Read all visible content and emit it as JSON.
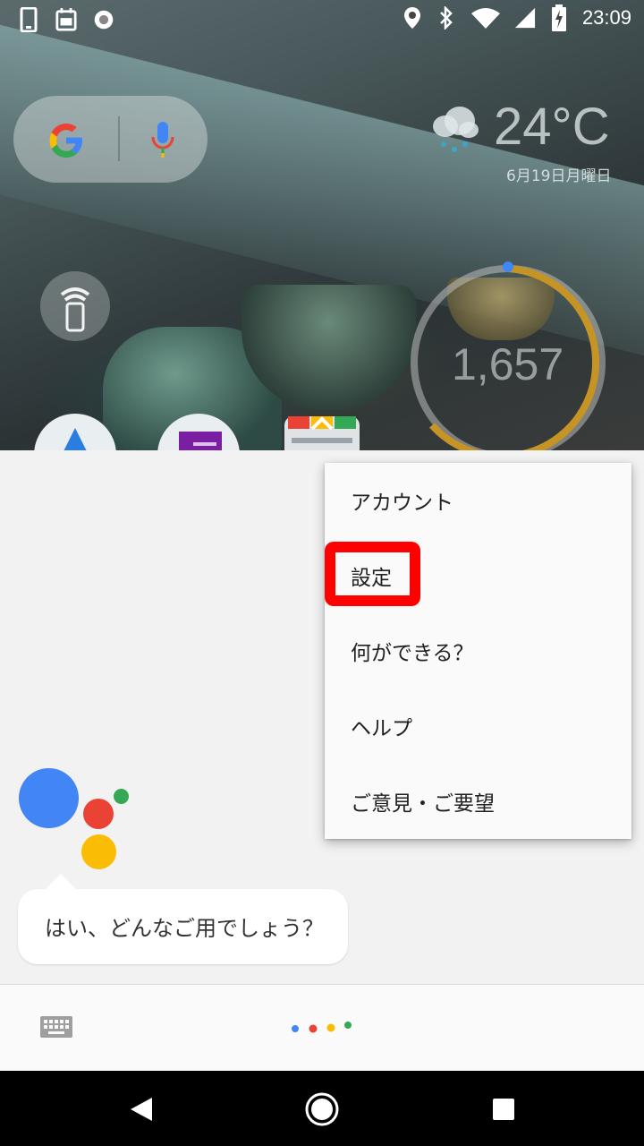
{
  "status_bar": {
    "time": "23:09",
    "left_icons": [
      "phone-outline-icon",
      "calendar-100-icon",
      "record-icon"
    ],
    "right_icons": [
      "location-icon",
      "bluetooth-icon",
      "wifi-icon",
      "signal-icon",
      "battery-charging-icon"
    ]
  },
  "home_widgets": {
    "temperature": "24°C",
    "date": "6月19日月曜日",
    "steps": "1,657"
  },
  "menu": {
    "items": [
      "アカウント",
      "設定",
      "何ができる？",
      "ヘルプ",
      "ご意見・ご要望"
    ]
  },
  "assistant": {
    "greeting": "はい、どんなご用でしょう？"
  },
  "colors": {
    "google_blue": "#4285f4",
    "google_red": "#ea4335",
    "google_yellow": "#fbbc05",
    "google_green": "#34a853",
    "highlight": "#ff0000"
  }
}
